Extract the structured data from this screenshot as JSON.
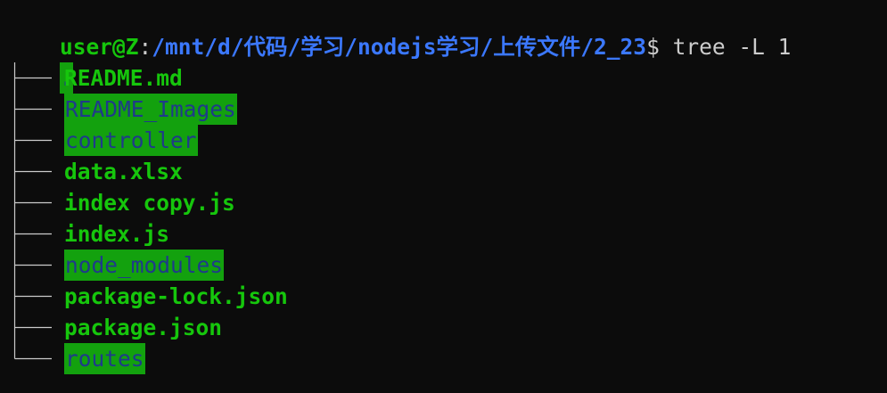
{
  "prompt": {
    "user_host": "user@Z",
    "colon": ":",
    "path": "/mnt/d/代码/学习/nodejs学习/上传文件/2_23",
    "dollar": "$",
    "command": " tree -L 1"
  },
  "tree": {
    "root": ".",
    "entries": [
      {
        "name": "README.md",
        "kind": "file"
      },
      {
        "name": "README_Images",
        "kind": "dir"
      },
      {
        "name": "controller",
        "kind": "dir"
      },
      {
        "name": "data.xlsx",
        "kind": "file"
      },
      {
        "name": "index copy.js",
        "kind": "file"
      },
      {
        "name": "index.js",
        "kind": "file"
      },
      {
        "name": "node_modules",
        "kind": "dir"
      },
      {
        "name": "package-lock.json",
        "kind": "file"
      },
      {
        "name": "package.json",
        "kind": "file"
      },
      {
        "name": "routes",
        "kind": "dir"
      }
    ]
  },
  "colors": {
    "background": "#0c0c0c",
    "file_green": "#16c60c",
    "dir_highlight": "#13a10e",
    "dir_text": "#1f3a8a",
    "path_blue": "#3b78ff"
  }
}
